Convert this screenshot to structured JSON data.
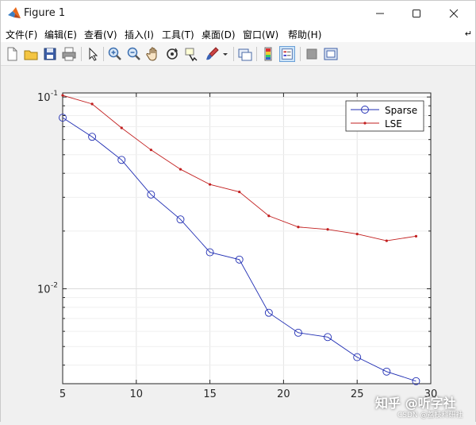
{
  "window": {
    "title": "Figure 1"
  },
  "menu": [
    {
      "label": "文件(F)"
    },
    {
      "label": "编辑(E)"
    },
    {
      "label": "查看(V)"
    },
    {
      "label": "插入(I)"
    },
    {
      "label": "工具(T)"
    },
    {
      "label": "桌面(D)"
    },
    {
      "label": "窗口(W)"
    },
    {
      "label": "帮助(H)"
    }
  ],
  "toolbar_icons": [
    "new-figure-icon",
    "open-file-icon",
    "save-icon",
    "print-icon",
    "pointer-icon",
    "zoom-in-icon",
    "zoom-out-icon",
    "pan-hand-icon",
    "rotate-3d-icon",
    "data-cursor-icon",
    "brush-icon",
    "brush-dropdown-icon",
    "link-plot-icon",
    "colorbar-icon",
    "legend-icon",
    "hide-plot-tools-icon",
    "show-plot-tools-icon"
  ],
  "watermark": {
    "text": "知乎 @听字社",
    "sub": "CSDN @荔枝科研社"
  },
  "chart_data": {
    "type": "line",
    "xlim": [
      5,
      30
    ],
    "ylim": [
      0.0032,
      0.105
    ],
    "yscale": "log",
    "grid": true,
    "legend_position": "top-right",
    "x_ticks": [
      "5",
      "10",
      "15",
      "20",
      "25",
      "30"
    ],
    "y_ticks": [
      {
        "base": "10",
        "exp": "-1",
        "value": 0.1
      },
      {
        "base": "10",
        "exp": "-2",
        "value": 0.01
      }
    ],
    "series": [
      {
        "name": "Sparse",
        "color": "#1f2db3",
        "marker": "circle",
        "x": [
          5,
          7,
          9,
          11,
          13,
          15,
          17,
          19,
          21,
          23,
          25,
          27,
          29
        ],
        "y": [
          0.078,
          0.062,
          0.047,
          0.031,
          0.023,
          0.0155,
          0.0142,
          0.0075,
          0.0059,
          0.0056,
          0.0044,
          0.0037,
          0.0033
        ]
      },
      {
        "name": "LSE",
        "color": "#c21f1f",
        "marker": "dot",
        "x": [
          5,
          7,
          9,
          11,
          13,
          15,
          17,
          19,
          21,
          23,
          25,
          27,
          29
        ],
        "y": [
          0.102,
          0.092,
          0.069,
          0.053,
          0.042,
          0.035,
          0.032,
          0.024,
          0.021,
          0.0204,
          0.0193,
          0.0178,
          0.0188
        ]
      }
    ]
  }
}
